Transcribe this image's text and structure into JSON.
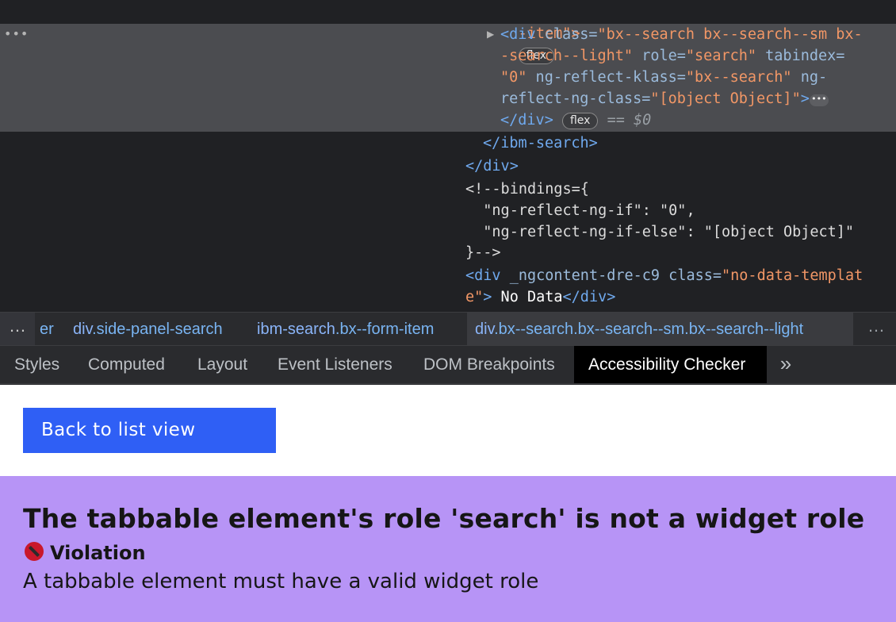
{
  "dom": {
    "line_item_end": "-item\">",
    "flex_badge": "flex",
    "gutter_dots": "•••",
    "expand_glyph": "▶",
    "sel_open": "<div",
    "sel_class_attr": " class=",
    "sel_class_val_1": "\"bx--search bx--search--sm bx-",
    "sel_class_val_2": "-search--light\"",
    "sel_role_attr": " role=",
    "sel_role_val": "\"search\"",
    "sel_tabindex_attr": " tabindex=",
    "sel_tabindex_val": "\"0\"",
    "sel_klass_attr": " ng-reflect-klass=",
    "sel_klass_val": "\"bx--search\"",
    "sel_ngclass_attr_1": " ng-",
    "sel_ngclass_attr_2": "reflect-ng-class=",
    "sel_ngclass_val": "\"[object Object]\"",
    "sel_gt": ">",
    "ellipsis": "•••",
    "sel_close": "</div>",
    "eq_dollar": " == ",
    "dollar0": "$0",
    "ibm_search_close": "</ibm-search>",
    "div_close": "</div>",
    "bindings_open": "<!--bindings={",
    "binding_1": "  \"ng-reflect-ng-if\": \"0\",",
    "binding_2": "  \"ng-reflect-ng-if-else\": \"[object Object]\"",
    "bindings_close": "}-->",
    "nodata_open": "<div",
    "nodata_attr": " _ngcontent-dre-c9 class=",
    "nodata_val_1": "\"no-data-templat",
    "nodata_val_2": "e\"",
    "nodata_gt": ">",
    "nodata_text": " No Data",
    "nodata_close": "</div>"
  },
  "breadcrumb": {
    "left_more": "…",
    "partial": "er",
    "items": [
      {
        "tag": "div",
        "cls": ".side-panel-search"
      },
      {
        "tag": "ibm-search",
        "cls": ".bx--form-item"
      },
      {
        "tag": "div",
        "cls": ".bx--search.bx--search--sm.bx--search--light"
      }
    ],
    "right_more": "…"
  },
  "tabs": [
    "Styles",
    "Computed",
    "Layout",
    "Event Listeners",
    "DOM Breakpoints",
    "Accessibility Checker"
  ],
  "tab_more": "»",
  "panel": {
    "back_button": "Back to list view",
    "issue_title": "The tabbable element's role 'search' is not a widget role",
    "violation_label": "Violation",
    "issue_desc": "A tabbable element must have a valid widget role"
  },
  "colors": {
    "primary_button": "#2f5ff5",
    "violation_bg": "#b794f6",
    "violation_icon": "#c9182b"
  }
}
